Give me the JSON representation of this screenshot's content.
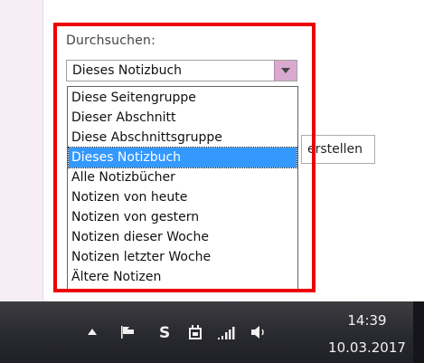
{
  "search": {
    "label": "Durchsuchen:",
    "selected_value": "Dieses Notizbuch",
    "options": [
      {
        "label": "Diese Seitengruppe",
        "selected": false
      },
      {
        "label": "Dieser Abschnitt",
        "selected": false
      },
      {
        "label": "Diese Abschnittsgruppe",
        "selected": false
      },
      {
        "label": "Dieses Notizbuch",
        "selected": true
      },
      {
        "label": "Alle Notizbücher",
        "selected": false
      },
      {
        "label": "Notizen von heute",
        "selected": false
      },
      {
        "label": "Notizen von gestern",
        "selected": false
      },
      {
        "label": "Notizen dieser Woche",
        "selected": false
      },
      {
        "label": "Notizen letzter Woche",
        "selected": false
      },
      {
        "label": "Ältere Notizen",
        "selected": false
      }
    ]
  },
  "create_button_label": "erstellen",
  "colors": {
    "highlight": "#ee0000",
    "selection": "#3399ff",
    "dropdown_button": "#d9a9cf",
    "taskbar": "#2a2b30"
  },
  "taskbar": {
    "icons": [
      "show-hidden-icons-arrow",
      "action-center-flag-icon",
      "skype-icon",
      "power-plug-icon",
      "network-signal-icon",
      "volume-icon"
    ],
    "time": "14:39",
    "date": "10.03.2017"
  }
}
